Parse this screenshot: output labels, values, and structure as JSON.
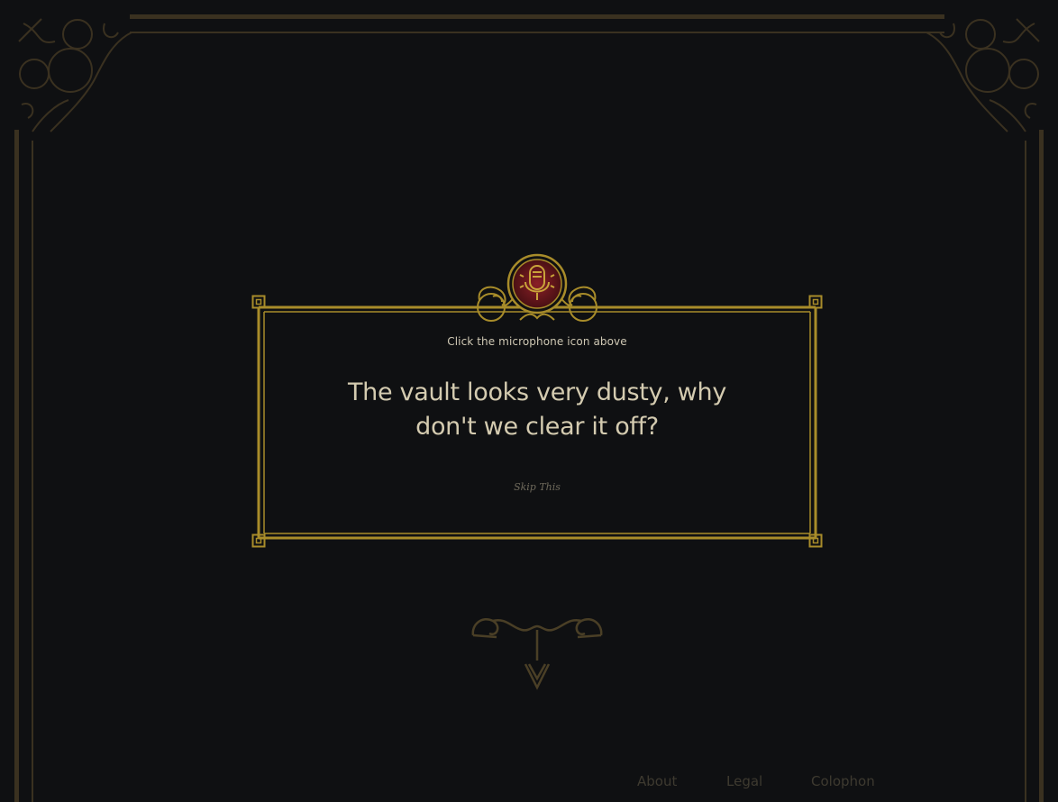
{
  "dialog": {
    "instruction": "Click the microphone icon above",
    "prompt": "The vault looks very dusty, why don't we clear it off?",
    "skip_label": "Skip This"
  },
  "footer": {
    "links": [
      {
        "label": "About"
      },
      {
        "label": "Legal"
      },
      {
        "label": "Colophon"
      }
    ]
  },
  "colors": {
    "background": "#0f1012",
    "gold": "#a88c2a",
    "dim_gold": "#3b3220",
    "mic_red": "#7a1a1e"
  },
  "icons": {
    "microphone": "microphone-icon",
    "scroll_down": "chevron-down-icon"
  }
}
